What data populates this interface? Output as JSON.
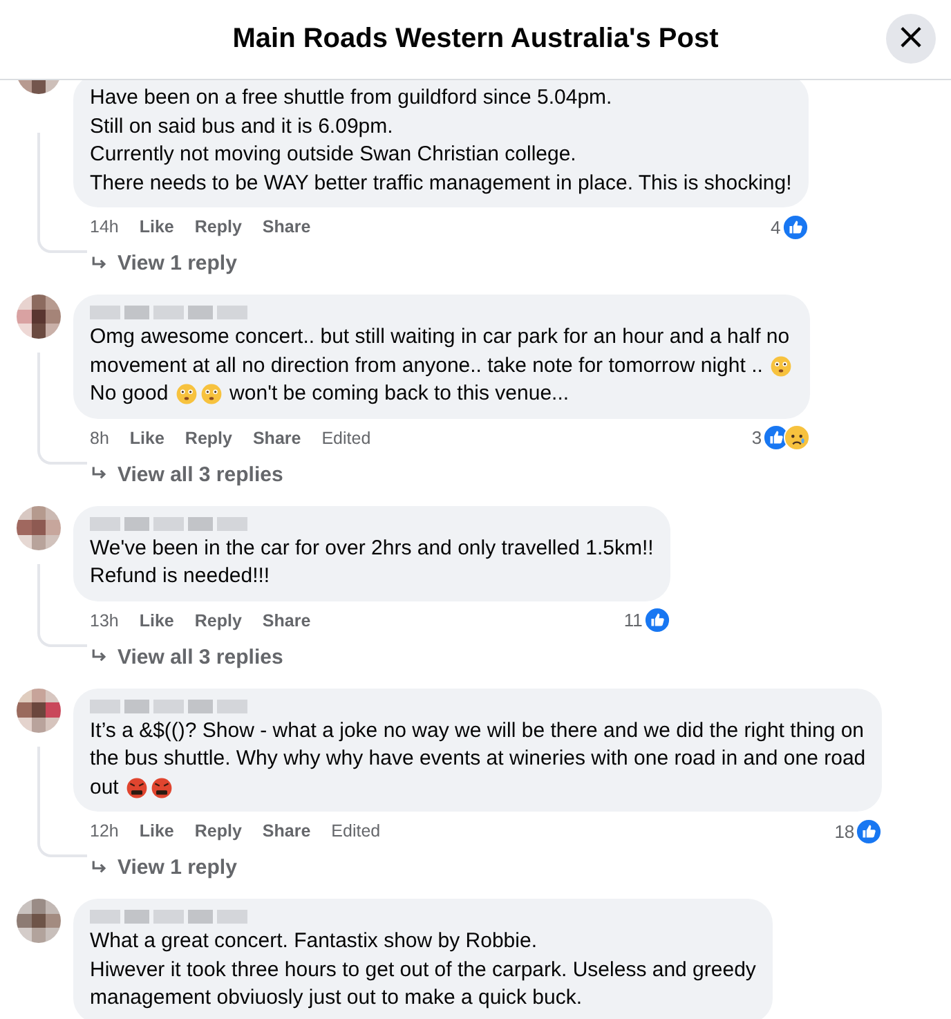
{
  "header": {
    "title": "Main Roads Western Australia's Post",
    "close": "×"
  },
  "comments": [
    {
      "lines": [
        [
          {
            "kind": "text",
            "text": "Have been on a free shuttle from guildford since 5.04pm."
          }
        ],
        [
          {
            "kind": "text",
            "text": "Still on said bus and it is 6.09pm."
          }
        ],
        [
          {
            "kind": "text",
            "text": "Currently not moving outside Swan Christian college."
          }
        ],
        [
          {
            "kind": "text",
            "text": "There needs to be WAY better traffic management in place. This is shocking!"
          }
        ]
      ],
      "time": "14h",
      "actions": [
        "Like",
        "Reply",
        "Share"
      ],
      "count": "4",
      "reactions": [
        {
          "kind": "like"
        }
      ],
      "replies": "View 1 reply"
    },
    {
      "blurred_name": true,
      "lines": [
        [
          {
            "kind": "text",
            "text": "Omg awesome concert.. but still waiting in car park for an hour and a half no"
          }
        ],
        [
          {
            "kind": "text",
            "text": "movement at all no direction from anyone.. take note for tomorrow night .. "
          },
          {
            "kind": "emoji"
          }
        ],
        [
          {
            "kind": "text",
            "text": "No good "
          },
          {
            "kind": "emoji"
          },
          {
            "kind": "emoji"
          },
          {
            "kind": "text",
            "text": " won't be coming back to this venue..."
          }
        ]
      ],
      "time": "8h",
      "actions": [
        "Like",
        "Reply",
        "Share"
      ],
      "edited": "Edited",
      "count": "3",
      "reactions": [
        {
          "kind": "like"
        },
        {
          "kind": "sad"
        }
      ],
      "replies": "View all 3 replies"
    },
    {
      "blurred_name": true,
      "lines": [
        [
          {
            "kind": "text",
            "text": "We've been in the car for over 2hrs and only travelled 1.5km!!"
          }
        ],
        [
          {
            "kind": "text",
            "text": "Refund is needed!!!"
          }
        ]
      ],
      "time": "13h",
      "actions": [
        "Like",
        "Reply",
        "Share"
      ],
      "count": "11",
      "reactions": [
        {
          "kind": "like"
        }
      ],
      "replies": "View all 3 replies"
    },
    {
      "blurred_name": true,
      "lines": [
        [
          {
            "kind": "text",
            "text": "It’s a &$(()? Show - what a joke no way we will be there and we did the right thing on"
          }
        ],
        [
          {
            "kind": "text",
            "text": "the bus shuttle. Why why why have events at wineries with one road in and one road"
          }
        ],
        [
          {
            "kind": "text",
            "text": "out "
          },
          {
            "kind": "angry-emoji"
          },
          {
            "kind": "angry-emoji"
          }
        ]
      ],
      "time": "12h",
      "actions": [
        "Like",
        "Reply",
        "Share"
      ],
      "edited": "Edited",
      "count": "18",
      "reactions": [
        {
          "kind": "like"
        }
      ],
      "replies": "View 1 reply"
    },
    {
      "blurred_name": true,
      "lines": [
        [
          {
            "kind": "text",
            "text": "What a great concert. Fantastix show by Robbie."
          }
        ],
        [
          {
            "kind": "text",
            "text": "Hiwever it took three hours to get out of the carpark. Useless and greedy"
          }
        ],
        [
          {
            "kind": "text",
            "text": "management obviuosly just out to make a quick buck."
          }
        ]
      ]
    }
  ]
}
